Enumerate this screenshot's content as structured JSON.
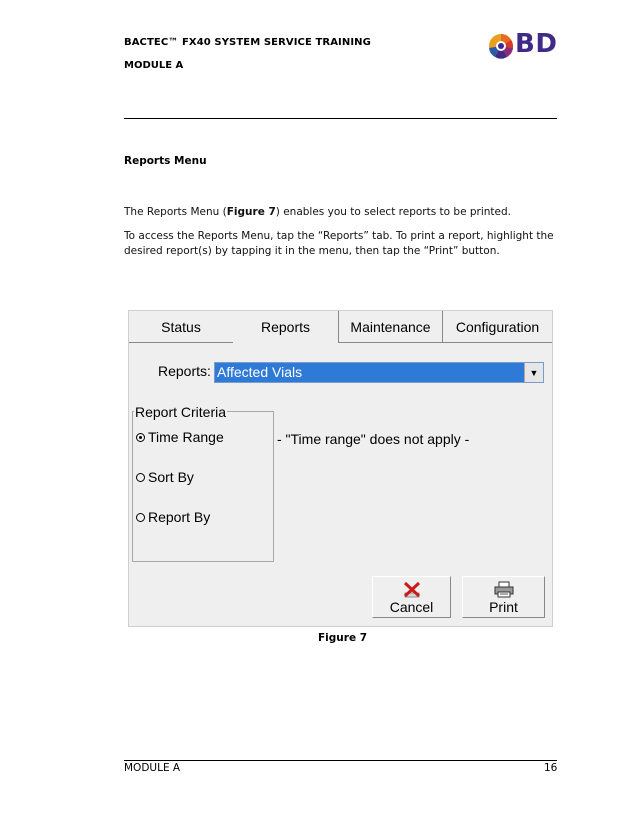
{
  "header": {
    "title": "BACTEC™ FX40 SYSTEM SERVICE TRAINING",
    "module": "MODULE A",
    "logo_text": "BD",
    "logo_color": "#3f2a88"
  },
  "section": {
    "heading": "Reports Menu",
    "para1_a": "The Reports Menu (",
    "para1_fig": "Figure 7",
    "para1_b": ") enables you to select reports to be printed.",
    "para2_line1": "To access the Reports Menu, tap the “Reports” tab.  To print a report, highlight the",
    "para2_line2": "desired report(s) by tapping it in the menu, then tap the “Print” button."
  },
  "screenshot": {
    "tabs": [
      "Status",
      "Reports",
      "Maintenance",
      "Configuration"
    ],
    "active_tab": "Reports",
    "reports_label": "Reports:",
    "reports_selected": "Affected Vials",
    "criteria_title": "Report Criteria",
    "criteria_options": [
      {
        "label": "Time Range",
        "selected": true
      },
      {
        "label": "Sort By",
        "selected": false
      },
      {
        "label": "Report By",
        "selected": false
      }
    ],
    "note": "- \"Time range\" does not apply -",
    "cancel_label": "Cancel",
    "print_label": "Print",
    "selection_color": "#2f7ad6"
  },
  "caption": "Figure 7",
  "footer": {
    "module": "MODULE A",
    "page": "16"
  }
}
